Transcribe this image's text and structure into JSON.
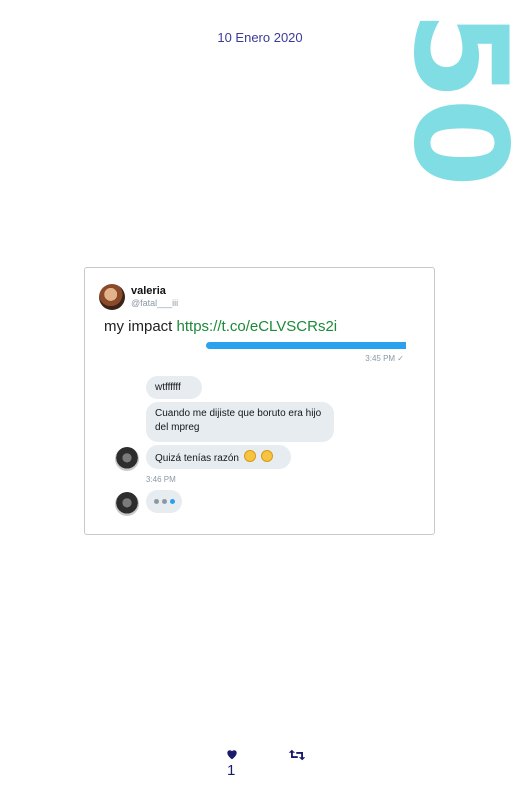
{
  "header": {
    "date": "10 Enero 2020",
    "number": "50"
  },
  "tweet": {
    "display_name": "valeria",
    "handle": "@fatal___iii",
    "text": "my impact",
    "link": "https://t.co/eCLVSCRs2i"
  },
  "chat": {
    "sent_time": "3:45 PM ✓",
    "messages": [
      {
        "text": "wtffffff"
      },
      {
        "text": "Cuando me dijiste que boruto era hijo del mpreg"
      },
      {
        "text": "Quizá tenías razón"
      }
    ],
    "received_time": "3:46 PM"
  },
  "footer": {
    "likes": "1"
  },
  "colors": {
    "accent_number": "#7fdde3",
    "date": "#3b3b9a",
    "link": "#1b8a39",
    "bar": "#2aa1ef"
  }
}
